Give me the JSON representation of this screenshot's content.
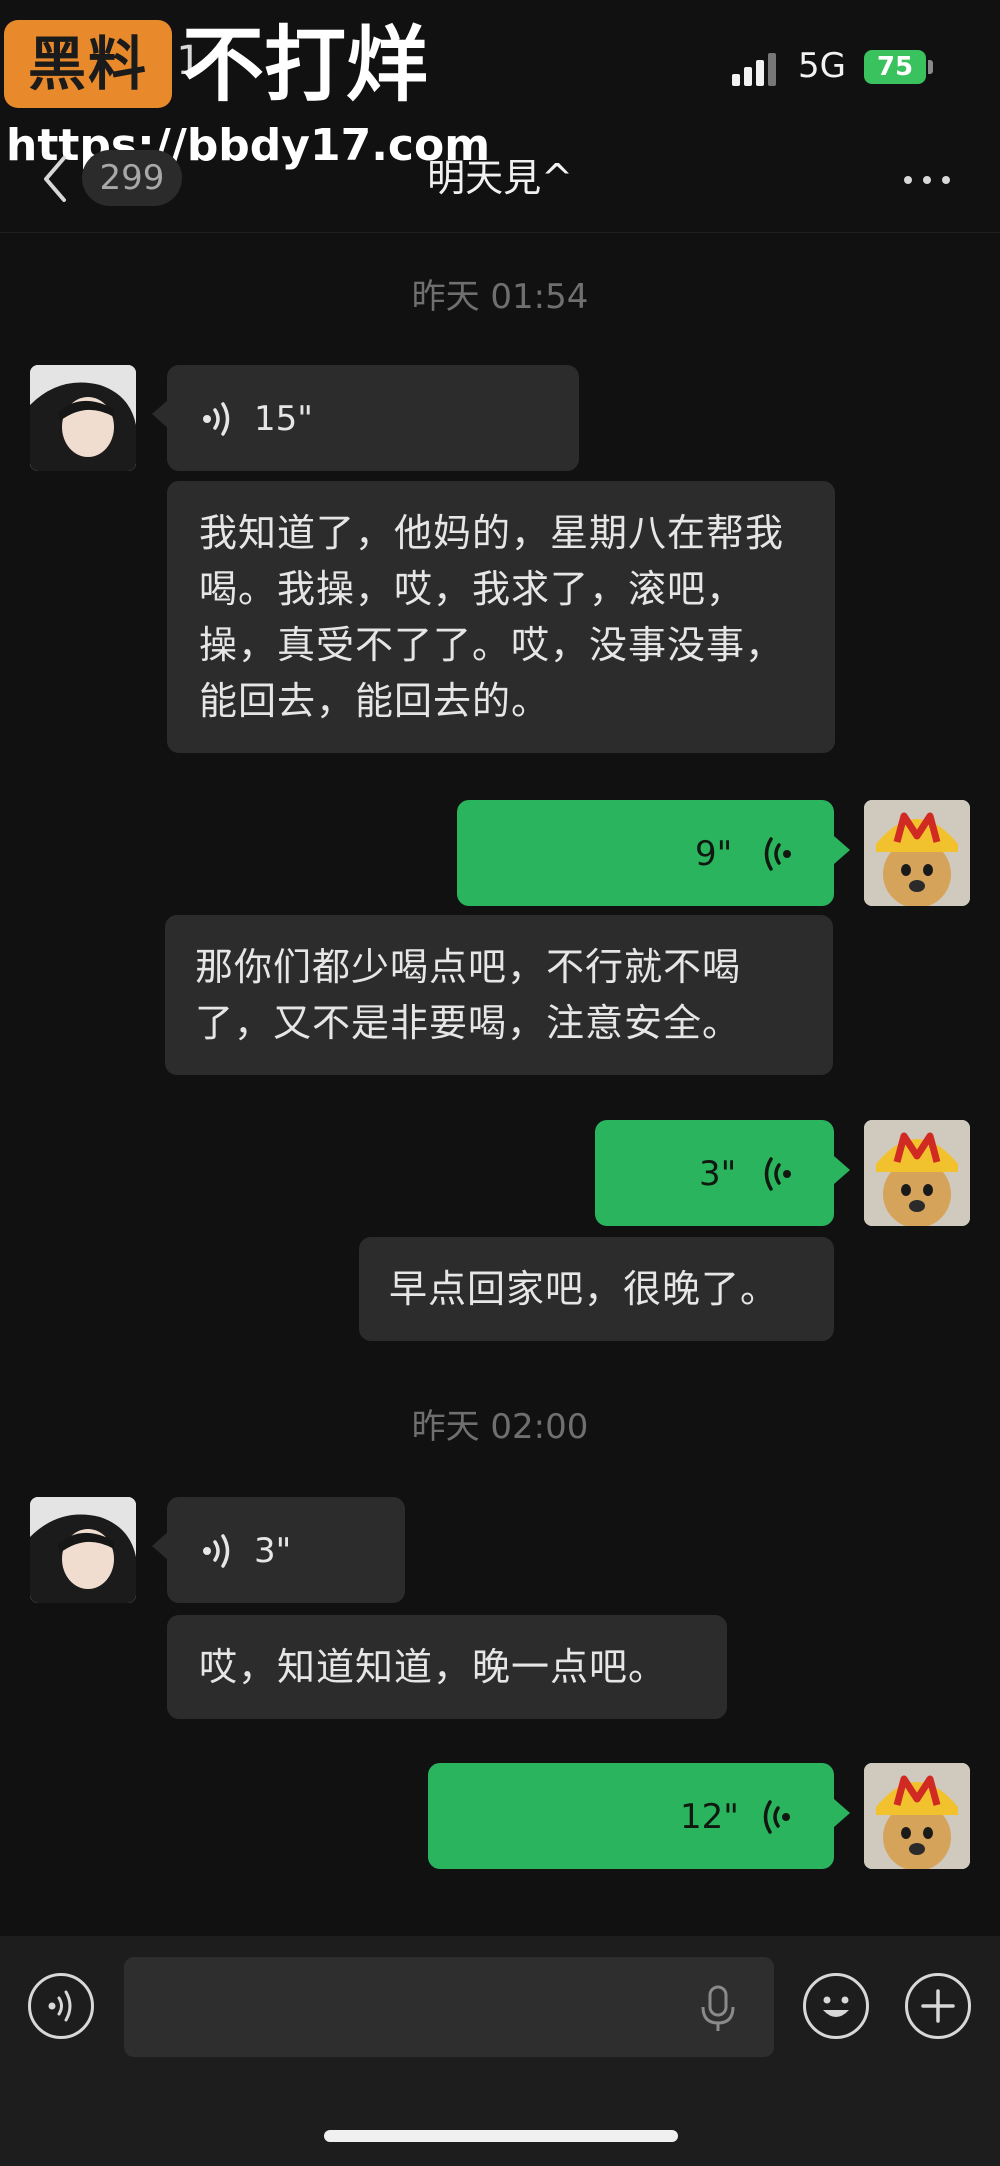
{
  "watermark": {
    "badge_text": "黑料",
    "title": "不打烊",
    "url": "https://bbdy17.com"
  },
  "status_bar": {
    "time_fragment": "05:1",
    "network": "5G",
    "battery": "75"
  },
  "header": {
    "unread_count": "299",
    "chat_title": "明天見^",
    "back_icon": "chevron-left-icon",
    "more_icon": "more-dots-icon"
  },
  "messages": {
    "ts1": "昨天 01:54",
    "m1_voice_duration": "15\"",
    "m2_text": "我知道了，他妈的，星期八在帮我喝。我操，哎，我求了，滚吧，操，真受不了了。哎，没事没事，能回去，能回去的。",
    "m3_voice_duration": "9\"",
    "m4_text": "那你们都少喝点吧，不行就不喝了，又不是非要喝，注意安全。",
    "m5_voice_duration": "3\"",
    "m6_text": "早点回家吧，很晚了。",
    "ts2": "昨天 02:00",
    "m7_voice_duration": "3\"",
    "m8_text": "哎，知道知道，晚一点吧。",
    "m9_voice_duration": "12\""
  },
  "input_bar": {
    "voice_icon": "voice-mode-icon",
    "mic_icon": "microphone-icon",
    "emoji_icon": "emoji-icon",
    "plus_icon": "plus-icon"
  },
  "colors": {
    "background": "#111111",
    "incoming_bubble": "#2c2c2c",
    "outgoing_bubble": "#2bb45e",
    "watermark_badge": "#e8892b",
    "battery": "#3ac25e"
  }
}
